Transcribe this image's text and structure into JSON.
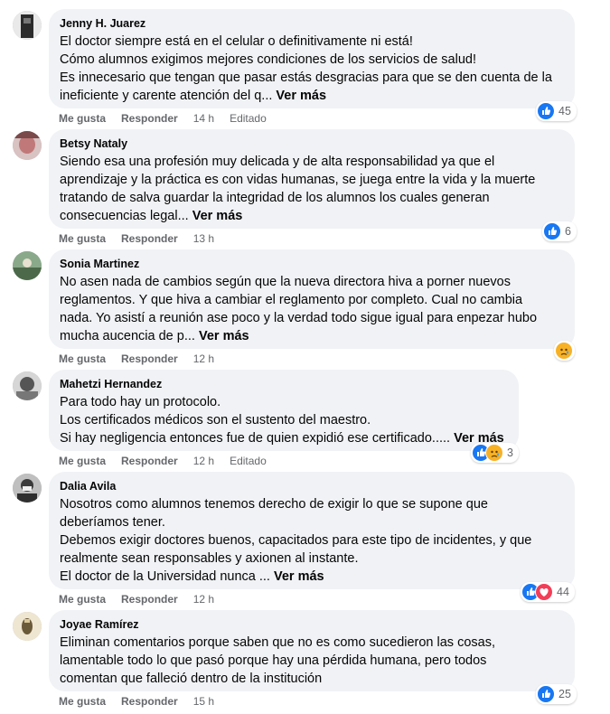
{
  "comments": [
    {
      "author": "Jenny H. Juarez",
      "lines": [
        "El doctor siempre está en el celular o definitivamente ni está!",
        "Cómo alumnos exigimos mejores condiciones de los servicios de salud!",
        "Es innecesario que tengan que pasar estás desgracias para que se den cuenta de la",
        "ineficiente y carente atención del q..."
      ],
      "see_more": "Ver más",
      "like": "Me gusta",
      "reply": "Responder",
      "time": "14 h",
      "edited": "Editado",
      "reactions": [
        "like"
      ],
      "reaction_count": "45",
      "avatar_color": "#3a3a3a"
    },
    {
      "author": "Betsy Nataly",
      "lines": [
        "Siendo esa una profesión muy delicada y de alta responsabilidad ya que el",
        "aprendizaje y la práctica es con vidas humanas, se juega entre la vida y la muerte",
        "tratando de salva guardar la integridad de los alumnos los cuales generan",
        "consecuencias legal..."
      ],
      "see_more": "Ver más",
      "like": "Me gusta",
      "reply": "Responder",
      "time": "13 h",
      "edited": "",
      "reactions": [
        "like"
      ],
      "reaction_count": "6",
      "avatar_color": "#c98a8a"
    },
    {
      "author": "Sonia Martinez",
      "lines": [
        "No asen nada de cambios según que la nueva directora hiva a porner nuevos",
        "reglamentos. Y que hiva a cambiar el reglamento por completo. Cual no cambia",
        "nada. Yo asistí a reunión ase poco y la verdad todo sigue igual para enpezar hubo",
        "mucha aucencia de p..."
      ],
      "see_more": "Ver más",
      "like": "Me gusta",
      "reply": "Responder",
      "time": "12 h",
      "edited": "",
      "reactions": [
        "sad"
      ],
      "reaction_count": "",
      "avatar_color": "#5e7d5a"
    },
    {
      "author": "Mahetzi Hernandez",
      "lines": [
        "Para todo hay un protocolo.",
        "Los certificados médicos son el sustento del maestro.",
        "Si hay negligencia entonces fue de quien expidió ese certificado....."
      ],
      "see_more": "Ver más",
      "like": "Me gusta",
      "reply": "Responder",
      "time": "12 h",
      "edited": "Editado",
      "reactions": [
        "like",
        "sad"
      ],
      "reaction_count": "3",
      "avatar_color": "#8c8c8c"
    },
    {
      "author": "Dalia Avila",
      "lines": [
        "Nosotros como alumnos tenemos derecho de exigir lo que se supone que",
        "deberíamos tener.",
        "Debemos exigir doctores buenos, capacitados para este tipo de incidentes, y que",
        "realmente sean responsables y axionen al instante.",
        "El doctor de la Universidad nunca ..."
      ],
      "see_more": "Ver más",
      "like": "Me gusta",
      "reply": "Responder",
      "time": "12 h",
      "edited": "",
      "reactions": [
        "like",
        "love"
      ],
      "reaction_count": "44",
      "avatar_color": "#6b6b6b"
    },
    {
      "author": "Joyae Ramírez",
      "lines": [
        "Eliminan comentarios porque saben que no es como sucedieron las cosas,",
        "lamentable todo lo que pasó porque hay una pérdida humana, pero todos",
        "comentan que falleció dentro de la institución"
      ],
      "see_more": "",
      "like": "Me gusta",
      "reply": "Responder",
      "time": "15 h",
      "edited": "",
      "reactions": [
        "like"
      ],
      "reaction_count": "25",
      "avatar_color": "#c9b48a"
    }
  ],
  "colors": {
    "bubble": "#f0f2f5",
    "meta": "#65676b",
    "like": "#1877f2",
    "love": "#f33e58",
    "sad": "#f7b125"
  }
}
